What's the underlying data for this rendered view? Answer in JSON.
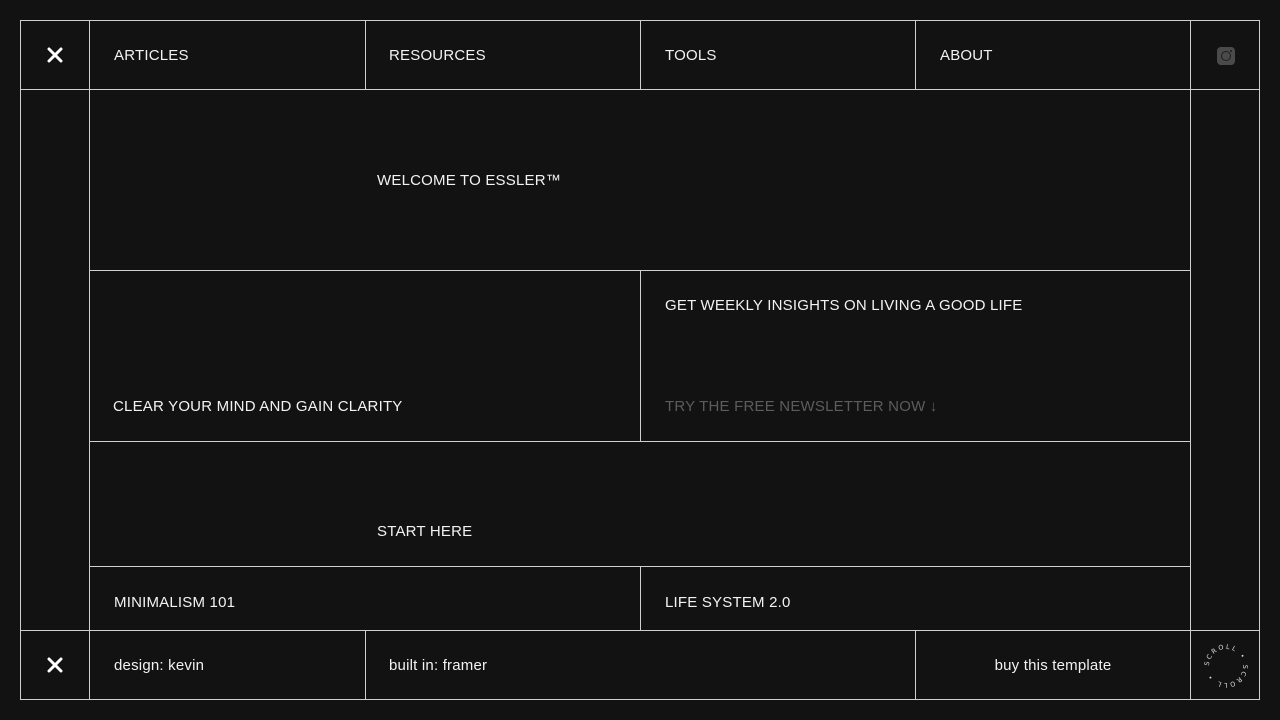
{
  "nav": {
    "logo_icon": "x-logo-icon",
    "items": [
      {
        "label": "ARTICLES"
      },
      {
        "label": "RESOURCES"
      },
      {
        "label": "TOOLS"
      },
      {
        "label": "ABOUT"
      }
    ],
    "social_icon": "instagram-icon"
  },
  "hero": {
    "welcome": "WELCOME TO ESSLER™"
  },
  "features": {
    "left": "CLEAR YOUR MIND AND GAIN CLARITY",
    "right_title": "GET WEEKLY INSIGHTS ON LIVING A GOOD LIFE",
    "right_cta": "TRY THE FREE NEWSLETTER NOW ↓"
  },
  "start": {
    "label": "START HERE"
  },
  "guides": [
    {
      "label": "MINIMALISM 101"
    },
    {
      "label": "LIFE SYSTEM 2.0"
    }
  ],
  "footer": {
    "logo_icon": "x-logo-icon",
    "design": "design: kevin",
    "built": "built in: framer",
    "buy": "buy this template",
    "scroll_badge": "SCROLL • SCROLL •"
  },
  "colors": {
    "background": "#121212",
    "line": "#cfcfcf",
    "text": "#f2f2f2",
    "muted": "#5c5c5c"
  }
}
